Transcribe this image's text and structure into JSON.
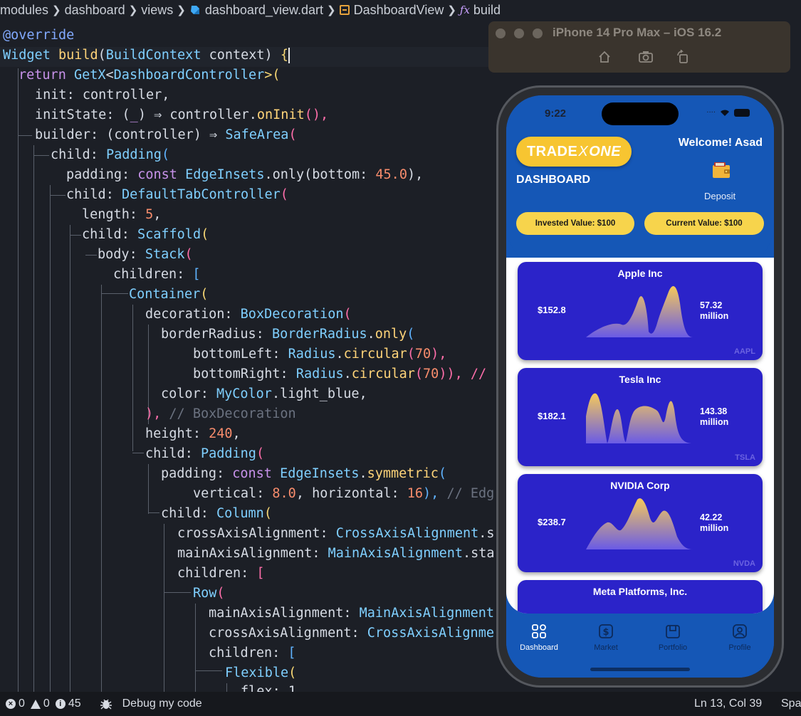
{
  "breadcrumb": {
    "seg1": "modules",
    "seg2": "dashboard",
    "seg3": "views",
    "seg4": "dashboard_view.dart",
    "seg5": "DashboardView",
    "seg6": "build"
  },
  "code": {
    "l0": "@override",
    "l1_a": "Widget",
    "l1_b": " build",
    "l1_c": "(",
    "l1_d": "BuildContext",
    "l1_e": " context) ",
    "l1_f": "{",
    "l2_a": "return ",
    "l2_b": "GetX",
    "l2_c": "<",
    "l2_d": "DashboardController",
    "l2_e": ">(",
    "l3_a": "init",
    "l3_b": ": controller,",
    "l4_a": "initState",
    "l4_b": ": (",
    "l4_c": "_",
    "l4_d": ") ⇒ controller.",
    "l4_e": "onInit",
    "l4_f": "(),",
    "l5_a": "builder",
    "l5_b": ": (controller) ⇒ ",
    "l5_c": "SafeArea",
    "l5_d": "(",
    "l6_a": "child",
    "l6_b": ": ",
    "l6_c": "Padding",
    "l6_d": "(",
    "l7_a": "padding",
    "l7_b": ": ",
    "l7_c": "const ",
    "l7_d": "EdgeInsets",
    "l7_e": ".only(bottom: ",
    "l7_f": "45.0",
    "l7_g": "),",
    "l8_a": "child",
    "l8_b": ": ",
    "l8_c": "DefaultTabController",
    "l8_d": "(",
    "l9_a": "length",
    "l9_b": ": ",
    "l9_c": "5",
    "l9_d": ",",
    "l10_a": "child",
    "l10_b": ": ",
    "l10_c": "Scaffold",
    "l10_d": "(",
    "l11_a": "body",
    "l11_b": ": ",
    "l11_c": "Stack",
    "l11_d": "(",
    "l12_a": "children",
    "l12_b": ": ",
    "l12_c": "[",
    "l13_a": "Container",
    "l13_b": "(",
    "l14_a": "decoration",
    "l14_b": ": ",
    "l14_c": "BoxDecoration",
    "l14_d": "(",
    "l15_a": "borderRadius",
    "l15_b": ": ",
    "l15_c": "BorderRadius",
    "l15_d": ".",
    "l15_e": "only",
    "l15_f": "(",
    "l16_a": "bottomLeft",
    "l16_b": ": ",
    "l16_c": "Radius",
    "l16_d": ".",
    "l16_e": "circular",
    "l16_f": "(",
    "l16_g": "70",
    "l16_h": "),",
    "l17_a": "bottomRight",
    "l17_b": ": ",
    "l17_c": "Radius",
    "l17_d": ".",
    "l17_e": "circular",
    "l17_f": "(",
    "l17_g": "70",
    "l17_h": ")), //",
    "l18_a": "color",
    "l18_b": ": ",
    "l18_c": "MyColor",
    "l18_d": ".light_blue,",
    "l19_a": "), ",
    "l19_b": "// BoxDecoration",
    "l20_a": "height",
    "l20_b": ": ",
    "l20_c": "240",
    "l20_d": ",",
    "l21_a": "child",
    "l21_b": ": ",
    "l21_c": "Padding",
    "l21_d": "(",
    "l22_a": "padding",
    "l22_b": ": ",
    "l22_c": "const ",
    "l22_d": "EdgeInsets",
    "l22_e": ".",
    "l22_f": "symmetric",
    "l22_g": "(",
    "l23_a": "vertical",
    "l23_b": ": ",
    "l23_c": "8.0",
    "l23_d": ", horizontal: ",
    "l23_e": "16",
    "l23_f": "), ",
    "l23_g": "// Edg",
    "l24_a": "child",
    "l24_b": ": ",
    "l24_c": "Column",
    "l24_d": "(",
    "l25_a": "crossAxisAlignment",
    "l25_b": ": ",
    "l25_c": "CrossAxisAlignment",
    "l25_d": ".s",
    "l26_a": "mainAxisAlignment",
    "l26_b": ": ",
    "l26_c": "MainAxisAlignment",
    "l26_d": ".sta",
    "l27_a": "children",
    "l27_b": ": ",
    "l27_c": "[",
    "l28_a": "Row",
    "l28_b": "(",
    "l29_a": "mainAxisAlignment",
    "l29_b": ": ",
    "l29_c": "MainAxisAlignment",
    "l30_a": "crossAxisAlignment",
    "l30_b": ": ",
    "l30_c": "CrossAxisAlignme",
    "l31_a": "children",
    "l31_b": ": ",
    "l31_c": "[",
    "l32_a": "Flexible",
    "l32_b": "(",
    "l33_a": "flex",
    "l33_b": ": 1"
  },
  "simulator": {
    "title": "iPhone 14 Pro Max – iOS 16.2"
  },
  "app": {
    "time": "9:22",
    "logo_trade": "TRADE",
    "logo_x": "X",
    "logo_one": "ONE",
    "dashboard_title": "DASHBOARD",
    "welcome": "Welcome! Asad",
    "deposit": "Deposit",
    "invested": "Invested Value: $100",
    "current": "Current Value: $100",
    "stocks": [
      {
        "name": "Apple Inc",
        "price": "$152.8",
        "vol1": "57.32",
        "vol2": "million",
        "ticker": "AAPL"
      },
      {
        "name": "Tesla Inc",
        "price": "$182.1",
        "vol1": "143.38",
        "vol2": "million",
        "ticker": "TSLA"
      },
      {
        "name": "NVIDIA Corp",
        "price": "$238.7",
        "vol1": "42.22",
        "vol2": "million",
        "ticker": "NVDA"
      },
      {
        "name": "Meta Platforms, Inc.",
        "price": "",
        "vol1": "",
        "vol2": "",
        "ticker": ""
      }
    ],
    "nav": [
      "Dashboard",
      "Market",
      "Portfolio",
      "Profile"
    ],
    "colors": {
      "header_blue": "#1557b6",
      "card_blue": "#2b23c9",
      "pill_yellow": "#f7d44c"
    }
  },
  "statusbar": {
    "errors": "0",
    "warnings": "0",
    "infos": "45",
    "debug": "Debug my code",
    "position": "Ln 13, Col 39",
    "spaces": "Spa"
  }
}
